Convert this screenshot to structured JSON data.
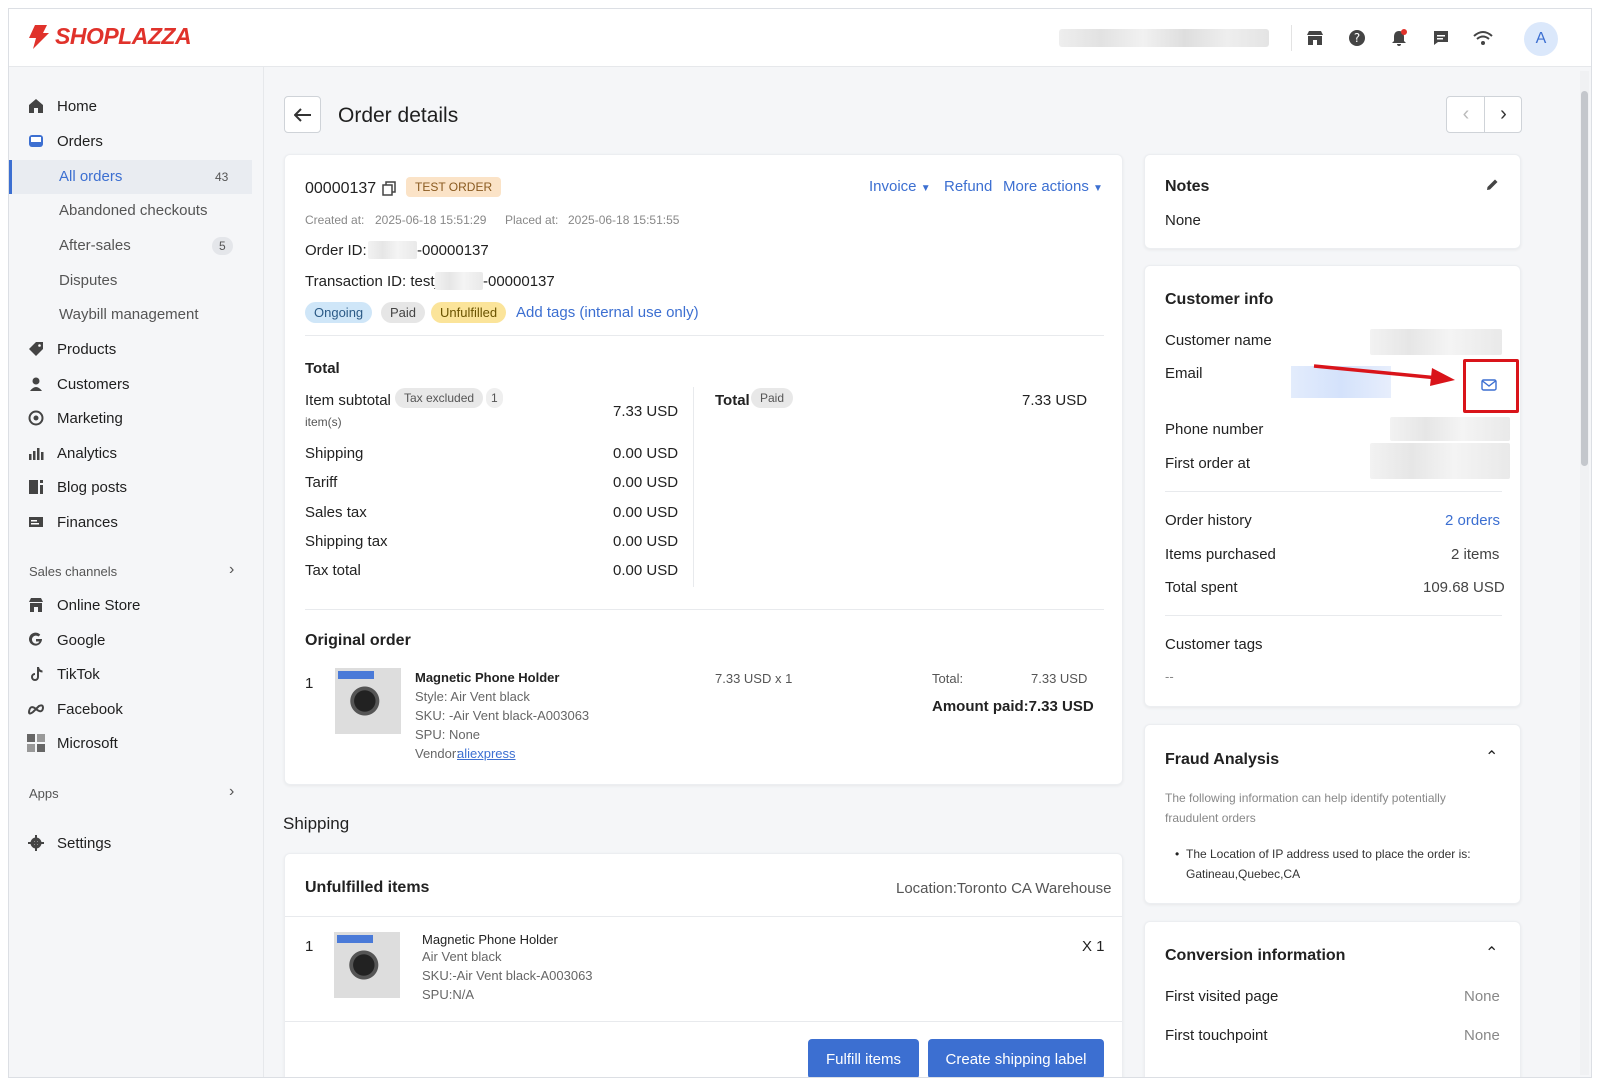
{
  "brand": {
    "name": "SHOPLAZZA"
  },
  "topbar": {
    "avatar_letter": "A",
    "icons": [
      "store-icon",
      "help-icon",
      "bell-icon",
      "chat-icon",
      "wifi-icon"
    ]
  },
  "sidebar": {
    "home": "Home",
    "orders": "Orders",
    "all_orders": "All orders",
    "all_orders_count": "43",
    "abandoned": "Abandoned checkouts",
    "after_sales": "After-sales",
    "after_sales_count": "5",
    "disputes": "Disputes",
    "waybill": "Waybill management",
    "products": "Products",
    "customers": "Customers",
    "marketing": "Marketing",
    "analytics": "Analytics",
    "blog": "Blog posts",
    "finances": "Finances",
    "sales_channels": "Sales channels",
    "online_store": "Online Store",
    "google": "Google",
    "tiktok": "TikTok",
    "facebook": "Facebook",
    "microsoft": "Microsoft",
    "apps": "Apps",
    "settings": "Settings"
  },
  "header": {
    "title": "Order details"
  },
  "order": {
    "number": "00000137",
    "test_badge": "TEST ORDER",
    "invoice": "Invoice",
    "refund": "Refund",
    "more_actions": "More actions",
    "created_label": "Created at:",
    "created_value": "2025-06-18 15:51:29",
    "placed_label": "Placed at:",
    "placed_value": "2025-06-18 15:51:55",
    "order_id_label": "Order ID:",
    "order_id_suffix": "-00000137",
    "txn_label": "Transaction ID: test_",
    "txn_suffix": "-00000137",
    "tags": {
      "ongoing": "Ongoing",
      "paid": "Paid",
      "unfulfilled": "Unfulfilled",
      "add": "Add tags (internal use only)"
    }
  },
  "total": {
    "heading": "Total",
    "item_subtotal": "Item subtotal",
    "tax_excluded": "Tax excluded",
    "items_count": "1",
    "items_unit": "item(s)",
    "item_subtotal_value": "7.33 USD",
    "shipping": "Shipping",
    "shipping_value": "0.00 USD",
    "tariff": "Tariff",
    "tariff_value": "0.00 USD",
    "sales_tax": "Sales tax",
    "sales_tax_value": "0.00 USD",
    "shipping_tax": "Shipping tax",
    "shipping_tax_value": "0.00 USD",
    "tax_total": "Tax total",
    "tax_total_value": "0.00 USD",
    "total_label": "Total",
    "paid_badge": "Paid",
    "total_value": "7.33 USD"
  },
  "original_order": {
    "heading": "Original order",
    "index": "1",
    "product": "Magnetic Phone Holder",
    "style": "Style: Air Vent black",
    "sku": "SKU: -Air Vent black-A003063",
    "spu": "SPU: None",
    "vendor_label": "Vendor:",
    "vendor": "aliexpress",
    "price_qty": "7.33 USD x 1",
    "total_label": "Total:",
    "total_value": "7.33 USD",
    "amount_paid": "Amount paid:7.33 USD"
  },
  "shipping": {
    "heading": "Shipping",
    "unfulfilled_heading": "Unfulfilled items",
    "location": "Location:Toronto CA Warehouse",
    "index": "1",
    "product": "Magnetic Phone Holder",
    "variant": "Air Vent black",
    "sku": "SKU:-Air Vent black-A003063",
    "spu": "SPU:N/A",
    "qty": "X 1",
    "fulfill_btn": "Fulfill items",
    "label_btn": "Create shipping label"
  },
  "notes": {
    "heading": "Notes",
    "value": "None"
  },
  "customer": {
    "heading": "Customer info",
    "name_label": "Customer name",
    "email_label": "Email",
    "phone_label": "Phone number",
    "first_order_label": "First order at",
    "history_label": "Order history",
    "history_value": "2 orders",
    "items_label": "Items purchased",
    "items_value": "2 items",
    "spent_label": "Total spent",
    "spent_value": "109.68 USD",
    "tags_label": "Customer tags",
    "tags_value": "--"
  },
  "fraud": {
    "heading": "Fraud Analysis",
    "desc1": "The following information can help identify potentially",
    "desc2": "fraudulent orders",
    "bullet1": "The Location of IP address used to place the order is:",
    "bullet2": "Gatineau,Quebec,CA"
  },
  "conversion": {
    "heading": "Conversion information",
    "first_page_label": "First visited page",
    "first_page_value": "None",
    "touch_label": "First touchpoint",
    "touch_value": "None"
  },
  "colors": {
    "accent": "#3c6fd1",
    "brand": "#e0322b",
    "highlight": "#d9141a"
  }
}
